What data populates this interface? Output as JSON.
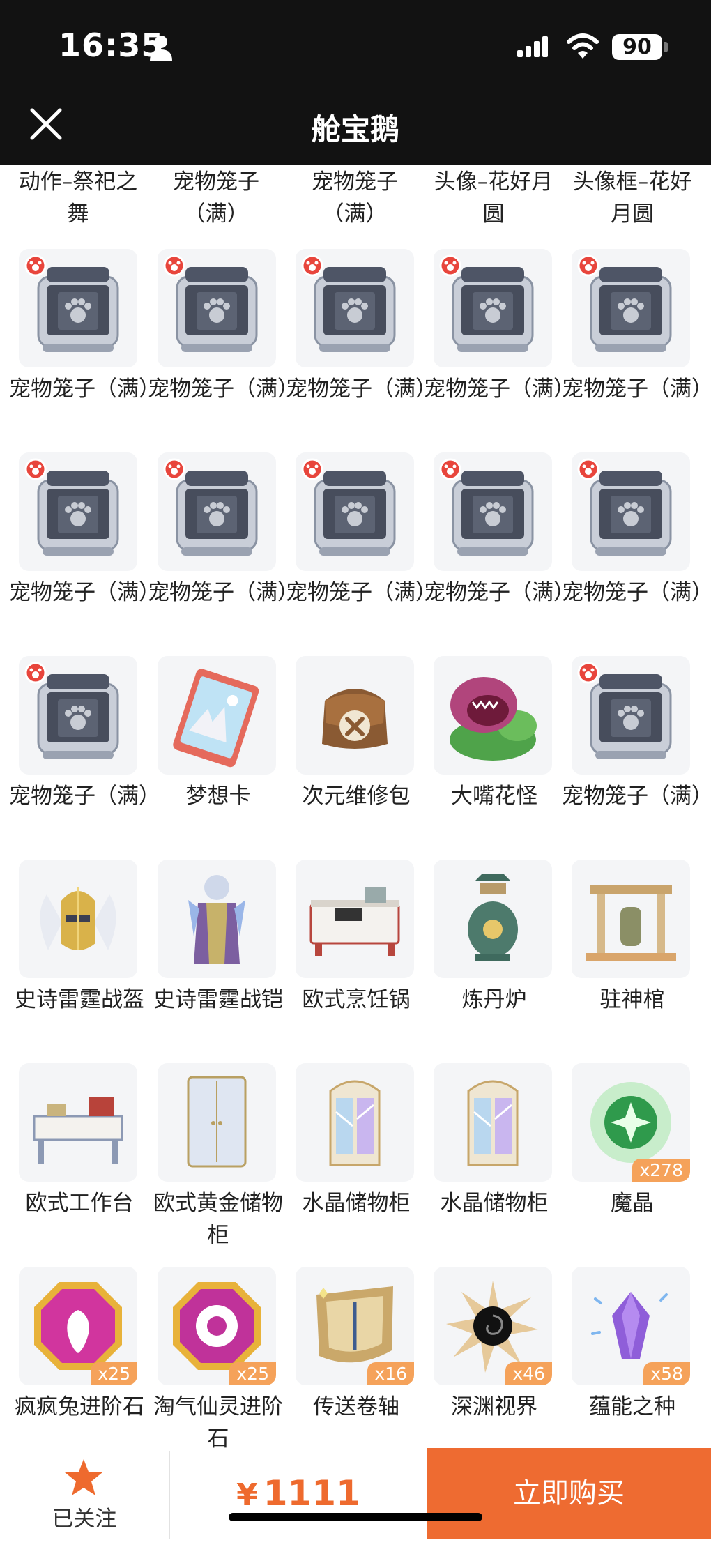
{
  "status_bar": {
    "time": "16:35",
    "battery": "90"
  },
  "header": {
    "title": "舱宝鹅"
  },
  "partial_row": [
    "动作–祭祀之舞",
    "宠物笼子（满）",
    "宠物笼子（满）",
    "头像–花好月圆",
    "头像框–花好月圆"
  ],
  "items": [
    {
      "name": "宠物笼子（满）",
      "icon": "pet-cage-icon",
      "qty": ""
    },
    {
      "name": "宠物笼子（满）",
      "icon": "pet-cage-icon",
      "qty": ""
    },
    {
      "name": "宠物笼子（满）",
      "icon": "pet-cage-icon",
      "qty": ""
    },
    {
      "name": "宠物笼子（满）",
      "icon": "pet-cage-icon",
      "qty": ""
    },
    {
      "name": "宠物笼子（满）",
      "icon": "pet-cage-icon",
      "qty": ""
    },
    {
      "name": "宠物笼子（满）",
      "icon": "pet-cage-icon",
      "qty": ""
    },
    {
      "name": "宠物笼子（满）",
      "icon": "pet-cage-icon",
      "qty": ""
    },
    {
      "name": "宠物笼子（满）",
      "icon": "pet-cage-icon",
      "qty": ""
    },
    {
      "name": "宠物笼子（满）",
      "icon": "pet-cage-icon",
      "qty": ""
    },
    {
      "name": "宠物笼子（满）",
      "icon": "pet-cage-icon",
      "qty": ""
    },
    {
      "name": "宠物笼子（满）",
      "icon": "pet-cage-icon",
      "qty": ""
    },
    {
      "name": "梦想卡",
      "icon": "dream-card-icon",
      "qty": ""
    },
    {
      "name": "次元维修包",
      "icon": "repair-bag-icon",
      "qty": ""
    },
    {
      "name": "大嘴花怪",
      "icon": "piranha-plant-icon",
      "qty": ""
    },
    {
      "name": "宠物笼子（满）",
      "icon": "pet-cage-icon",
      "qty": ""
    },
    {
      "name": "史诗雷霆战盔",
      "icon": "winged-helmet-icon",
      "qty": ""
    },
    {
      "name": "史诗雷霆战铠",
      "icon": "armor-icon",
      "qty": ""
    },
    {
      "name": "欧式烹饪锅",
      "icon": "stove-icon",
      "qty": ""
    },
    {
      "name": "炼丹炉",
      "icon": "alchemy-furnace-icon",
      "qty": ""
    },
    {
      "name": "驻神棺",
      "icon": "shrine-icon",
      "qty": ""
    },
    {
      "name": "欧式工作台",
      "icon": "desk-icon",
      "qty": ""
    },
    {
      "name": "欧式黄金储物柜",
      "icon": "wardrobe-icon",
      "qty": ""
    },
    {
      "name": "水晶储物柜",
      "icon": "crystal-cabinet-icon",
      "qty": ""
    },
    {
      "name": "水晶储物柜",
      "icon": "crystal-cabinet-icon",
      "qty": ""
    },
    {
      "name": "魔晶",
      "icon": "magic-crystal-icon",
      "qty": "x278"
    },
    {
      "name": "疯疯兔进阶石",
      "icon": "rabbit-gem-icon",
      "qty": "x25"
    },
    {
      "name": "淘气仙灵进阶石",
      "icon": "fairy-gem-icon",
      "qty": "x25"
    },
    {
      "name": "传送卷轴",
      "icon": "scroll-icon",
      "qty": "x16"
    },
    {
      "name": "深渊视界",
      "icon": "abyss-vortex-icon",
      "qty": "x46"
    },
    {
      "name": "蕴能之种",
      "icon": "energy-seed-icon",
      "qty": "x58"
    }
  ],
  "bottom_bar": {
    "follow_label": "已关注",
    "currency": "¥",
    "price": "1111",
    "buy_label": "立即购买"
  }
}
